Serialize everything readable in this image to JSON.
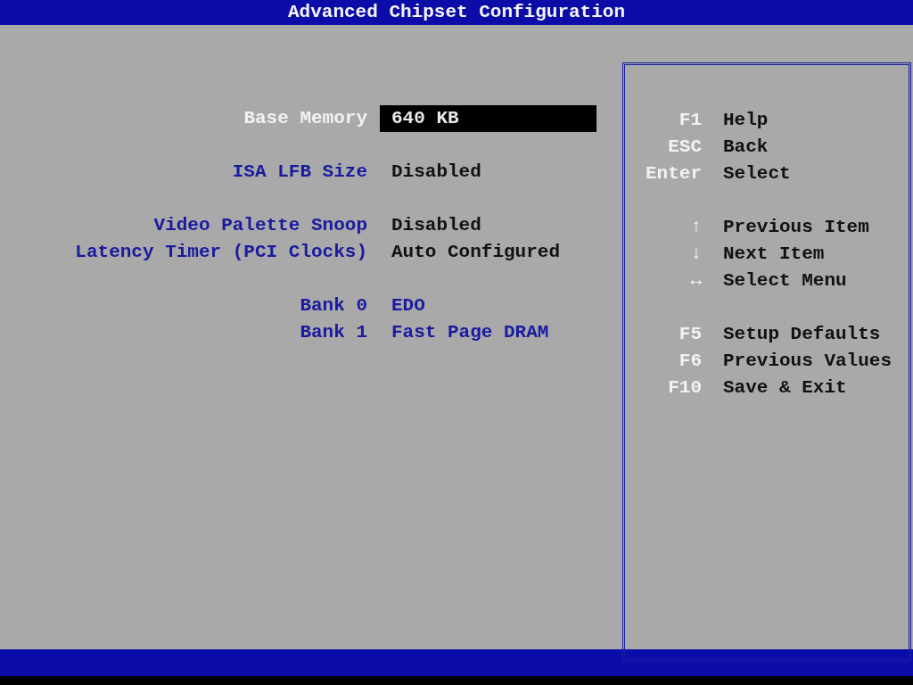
{
  "window": {
    "title": "Advanced Chipset Configuration"
  },
  "settings": [
    {
      "items": [
        {
          "label": "Base Memory",
          "value": "640 KB",
          "kind": "editable",
          "selected": true
        }
      ]
    },
    {
      "items": [
        {
          "label": "ISA LFB Size",
          "value": "Disabled",
          "kind": "editable",
          "selected": false
        }
      ]
    },
    {
      "items": [
        {
          "label": "Video Palette Snoop",
          "value": "Disabled",
          "kind": "editable",
          "selected": false
        },
        {
          "label": "Latency Timer (PCI Clocks)",
          "value": "Auto Configured",
          "kind": "editable",
          "selected": false
        }
      ]
    },
    {
      "items": [
        {
          "label": "Bank 0",
          "value": "EDO",
          "kind": "info",
          "selected": false
        },
        {
          "label": "Bank 1",
          "value": "Fast Page DRAM",
          "kind": "info",
          "selected": false
        }
      ]
    }
  ],
  "help": [
    {
      "keys": [
        {
          "key": "F1",
          "action": "Help"
        },
        {
          "key": "ESC",
          "action": "Back"
        },
        {
          "key": "Enter",
          "action": "Select"
        }
      ]
    },
    {
      "keys": [
        {
          "key": "↑",
          "action": "Previous Item"
        },
        {
          "key": "↓",
          "action": "Next Item"
        },
        {
          "key": "↔",
          "action": "Select Menu"
        }
      ]
    },
    {
      "keys": [
        {
          "key": "F5",
          "action": "Setup Defaults"
        },
        {
          "key": "F6",
          "action": "Previous Values"
        },
        {
          "key": "F10",
          "action": "Save & Exit"
        }
      ]
    }
  ]
}
